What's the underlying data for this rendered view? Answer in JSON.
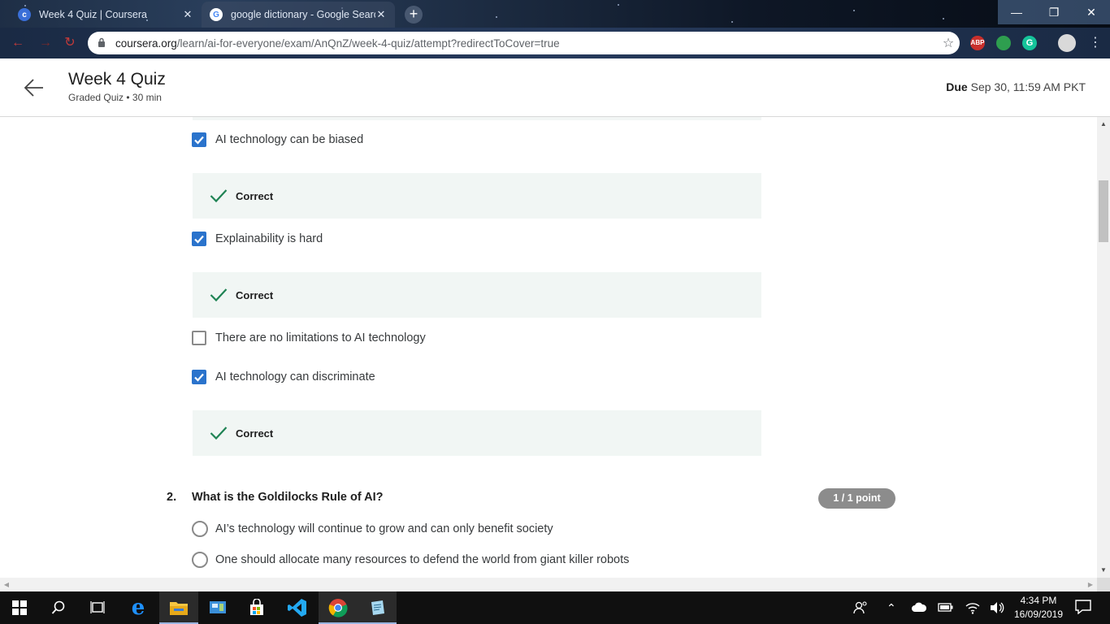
{
  "browser": {
    "tabs": [
      {
        "title": "Week 4 Quiz | Coursera",
        "icon": "coursera-icon",
        "active": false
      },
      {
        "title": "google dictionary - Google Searc",
        "icon": "google-icon",
        "active": true
      }
    ],
    "new_tab_icon": "plus-icon",
    "url_host": "coursera.org",
    "url_path": "/learn/ai-for-everyone/exam/AnQnZ/week-4-quiz/attempt?redirectToCover=true",
    "extensions": [
      {
        "name": "adblock-icon",
        "badge": "ABP",
        "count": "7",
        "color": "#c9302c"
      },
      {
        "name": "extension-globe-icon",
        "color": "#2e9e4f"
      },
      {
        "name": "grammarly-icon",
        "badge": "G",
        "color": "#15c39a"
      },
      {
        "name": "profile-avatar-icon",
        "color": "#d9d9d9"
      }
    ]
  },
  "header": {
    "title": "Week 4 Quiz",
    "subtitle": "Graded Quiz • 30 min",
    "due_label": "Due",
    "due_value": "Sep 30, 11:59 AM PKT"
  },
  "question1": {
    "options": [
      {
        "label": "AI technology can be biased",
        "checked": true,
        "feedback": "Correct"
      },
      {
        "label": "Explainability is hard",
        "checked": true,
        "feedback": "Correct"
      },
      {
        "label": "There are no limitations to AI technology",
        "checked": false,
        "feedback": null
      },
      {
        "label": "AI technology can discriminate",
        "checked": true,
        "feedback": "Correct"
      }
    ]
  },
  "question2": {
    "number": "2.",
    "text": "What is the Goldilocks Rule of AI?",
    "points": "1 / 1 point",
    "options": [
      {
        "label": "AI’s technology will continue to grow and can only benefit society"
      },
      {
        "label": "One should allocate many resources to defend the world from giant killer robots"
      }
    ]
  },
  "taskbar": {
    "clock_time": "4:34 PM",
    "clock_date": "16/09/2019",
    "apps": [
      "start-icon",
      "search-icon",
      "task-view-icon",
      "edge-icon",
      "file-explorer-icon",
      "control-panel-icon",
      "store-icon",
      "vscode-icon",
      "chrome-icon",
      "notepad-icon"
    ]
  },
  "colors": {
    "accent": "#2a73cc",
    "feedback_bg": "#f1f6f4",
    "check_green": "#1f8354",
    "points_badge": "#8c8c8c"
  }
}
